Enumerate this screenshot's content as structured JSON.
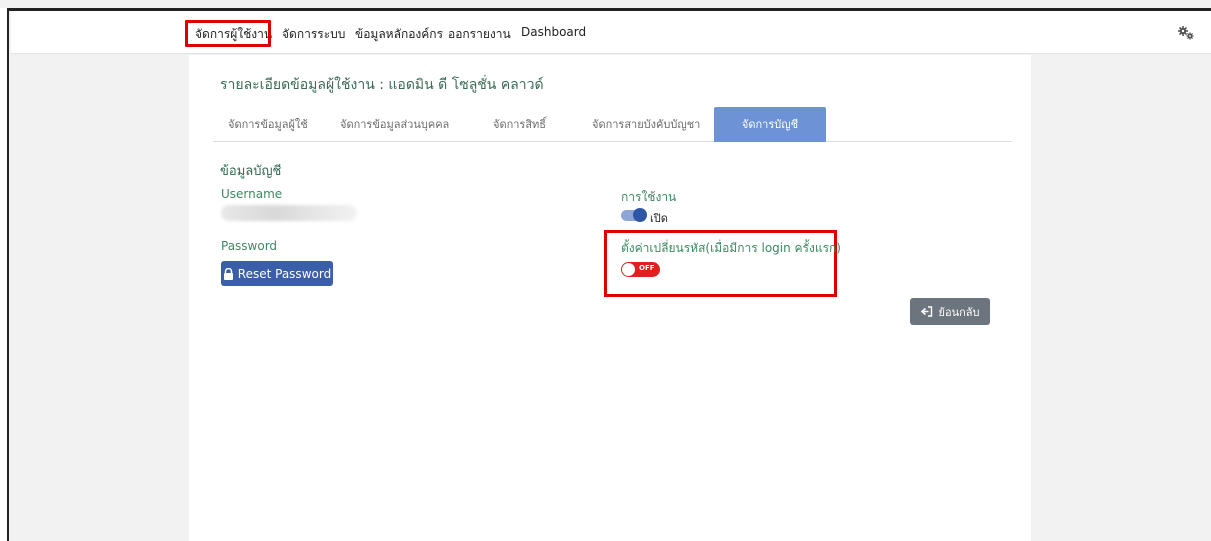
{
  "nav": {
    "items": [
      {
        "label": "จัดการผู้ใช้งาน"
      },
      {
        "label": "จัดการระบบ"
      },
      {
        "label": "ข้อมูลหลักองค์กร"
      },
      {
        "label": "ออกรายงาน"
      },
      {
        "label": "Dashboard"
      }
    ],
    "settings_icon": "gears-icon"
  },
  "page": {
    "title": "รายละเอียดข้อมูลผู้ใช้งาน : แอดมิน ดี โซลูชั่น คลาวด์",
    "tabs": [
      {
        "label": "จัดการข้อมูลผู้ใช้",
        "active": false
      },
      {
        "label": "จัดการข้อมูลส่วนบุคคล",
        "active": false
      },
      {
        "label": "จัดการสิทธิ์",
        "active": false
      },
      {
        "label": "จัดการสายบังคับบัญชา",
        "active": false
      },
      {
        "label": "จัดการบัญชี",
        "active": true
      }
    ]
  },
  "account": {
    "section_title": "ข้อมูลบัญชี",
    "username_label": "Username",
    "password_label": "Password",
    "reset_password_label": "Reset Password",
    "usage_label": "การใช้งาน",
    "usage_state_text": "เปิด",
    "usage_enabled": true,
    "force_change_label": "ตั้งค่าเปลี่ยนรหัส(เมื่อมีการ login ครั้งแรก)",
    "force_change_state_text": "OFF",
    "force_change_enabled": false,
    "back_label": "ย้อนกลับ"
  },
  "colors": {
    "accent": "#6d93d6",
    "primary_button": "#3b5ea8",
    "label_green": "#3c8a62",
    "off_red": "#e02020",
    "highlight_red": "#e00000",
    "back_button": "#6c757d"
  }
}
